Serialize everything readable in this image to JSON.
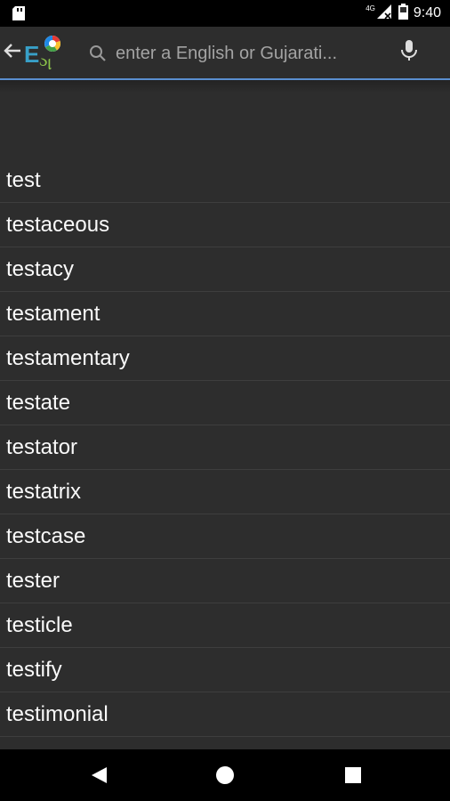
{
  "status_bar": {
    "time": "9:40",
    "network_type": "4G"
  },
  "toolbar": {
    "search_placeholder": "enter a English or Gujarati..."
  },
  "words": [
    "test",
    "testaceous",
    "testacy",
    "testament",
    "testamentary",
    "testate",
    "testator",
    "testatrix",
    "testcase",
    "tester",
    "testicle",
    "testify",
    "testimonial"
  ],
  "icons": {
    "back": "arrow-left-icon",
    "search": "search-icon",
    "mic": "microphone-icon",
    "nav_back": "triangle-back-icon",
    "nav_home": "circle-home-icon",
    "nav_recent": "square-recent-icon"
  },
  "colors": {
    "accent_underline": "#5a8fd0",
    "background": "#2d2d2d"
  }
}
